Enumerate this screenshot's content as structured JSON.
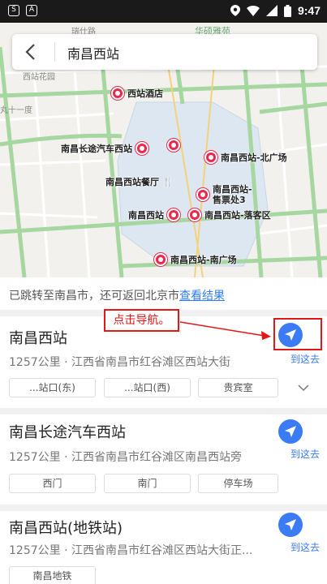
{
  "status_bar": {
    "time": "9:47",
    "left_icons": [
      "S",
      "A"
    ]
  },
  "search": {
    "query": "南昌西站"
  },
  "map": {
    "street_labels": [
      "瑞仕路",
      "华硕雅苑",
      "西站花园",
      "丸十一度"
    ],
    "pois": [
      {
        "name": "西站酒店"
      },
      {
        "name": "南昌长途汽车西站"
      },
      {
        "name": "南昌西站-北广场"
      },
      {
        "name": "南昌西站餐厅"
      },
      {
        "name": "南昌西站-"
      },
      {
        "name": "售票处3"
      },
      {
        "name": "南昌西站"
      },
      {
        "name": "南昌西站-落客区"
      },
      {
        "name": "南昌西站-南广场"
      }
    ]
  },
  "notice": {
    "text": "已跳转至南昌市，还可返回北京市",
    "link": "查看结果"
  },
  "annotation": {
    "callout": "点击导航。"
  },
  "results": [
    {
      "title": "南昌西站",
      "address": "1257公里 · 江西省南昌市红谷滩区西站大街",
      "goto": "到这去",
      "chips": [
        "...站口(东)",
        "...站口(西)",
        "贵宾室"
      ]
    },
    {
      "title": "南昌长途汽车西站",
      "address": "1257公里 · 江西省南昌市红谷滩区南昌西站旁",
      "goto": "到这去",
      "chips": [
        "西门",
        "南门",
        "停车场"
      ]
    },
    {
      "title": "南昌西站(地铁站)",
      "address": "1257公里 · 江西省南昌市红谷滩区西站大街正...",
      "goto": "到这去",
      "chips": [
        "南昌地铁"
      ]
    }
  ]
}
